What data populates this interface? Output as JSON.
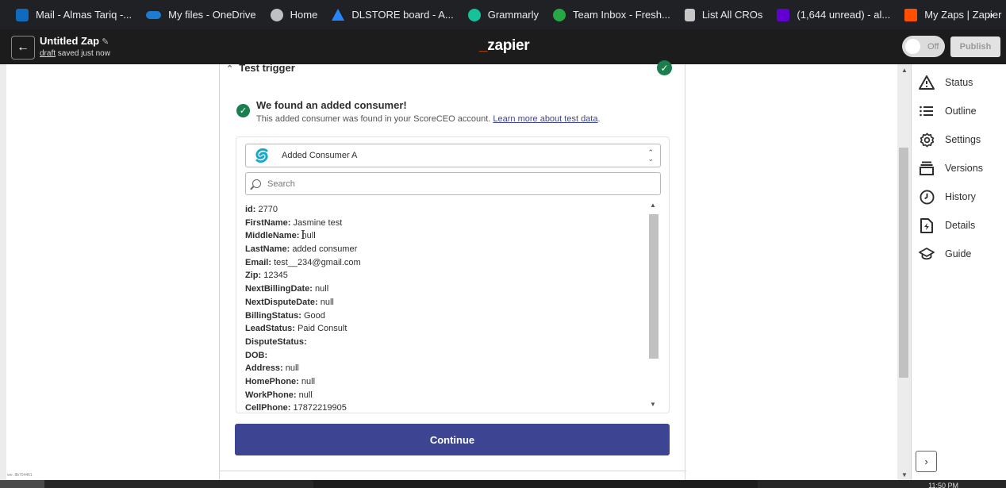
{
  "bookmarks": [
    {
      "label": "Mail - Almas Tariq -...",
      "icon": "outlook-icon",
      "color": "#0f6cbd"
    },
    {
      "label": "My files - OneDrive",
      "icon": "onedrive-icon",
      "color": "#1e7bd2"
    },
    {
      "label": "Home",
      "icon": "globe-icon",
      "color": "#bdc1c6"
    },
    {
      "label": "DLSTORE board - A...",
      "icon": "jira-icon",
      "color": "#2684ff"
    },
    {
      "label": "Grammarly",
      "icon": "grammarly-icon",
      "color": "#15c39a"
    },
    {
      "label": "Team Inbox - Fresh...",
      "icon": "freshchat-icon",
      "color": "#27a844"
    },
    {
      "label": "List All CROs",
      "icon": "doc-icon",
      "color": "#c7c7c7"
    },
    {
      "label": "(1,644 unread) - al...",
      "icon": "yahoo-icon",
      "color": "#6001d2"
    },
    {
      "label": "My Zaps | Zapier",
      "icon": "zapier-icon",
      "color": "#ff4f00"
    }
  ],
  "bookmarks_more": "»",
  "header": {
    "title": "Untitled Zap",
    "draft_label": "draft",
    "saved_text": "saved just now",
    "logo": "zapier",
    "toggle_label": "Off",
    "publish_label": "Publish"
  },
  "step": {
    "section_title": "Test trigger",
    "found_title": "We found an added consumer!",
    "found_desc": "This added consumer was found in your ScoreCEO account.",
    "learn_more": "Learn more about test data",
    "period": ".",
    "selected_record": "Added Consumer A",
    "search_placeholder": "Search",
    "fields": [
      {
        "k": "id:",
        "v": "2770"
      },
      {
        "k": "FirstName:",
        "v": "Jasmine test"
      },
      {
        "k": "MiddleName:",
        "v": "null"
      },
      {
        "k": "LastName:",
        "v": "added consumer"
      },
      {
        "k": "Email:",
        "v": "test__234@gmail.com"
      },
      {
        "k": "Zip:",
        "v": "12345"
      },
      {
        "k": "NextBillingDate:",
        "v": "null"
      },
      {
        "k": "NextDisputeDate:",
        "v": "null"
      },
      {
        "k": "BillingStatus:",
        "v": "Good"
      },
      {
        "k": "LeadStatus:",
        "v": "Paid Consult"
      },
      {
        "k": "DisputeStatus:",
        "v": ""
      },
      {
        "k": "DOB:",
        "v": ""
      },
      {
        "k": "Address:",
        "v": "null"
      },
      {
        "k": "HomePhone:",
        "v": "null"
      },
      {
        "k": "WorkPhone:",
        "v": "null"
      },
      {
        "k": "CellPhone:",
        "v": "17872219905"
      }
    ],
    "continue_label": "Continue"
  },
  "sidebar": {
    "items": [
      {
        "label": "Status",
        "icon": "warning-icon"
      },
      {
        "label": "Outline",
        "icon": "list-icon"
      },
      {
        "label": "Settings",
        "icon": "gear-icon"
      },
      {
        "label": "Versions",
        "icon": "versions-icon"
      },
      {
        "label": "History",
        "icon": "clock-icon"
      },
      {
        "label": "Details",
        "icon": "file-bolt-icon"
      },
      {
        "label": "Guide",
        "icon": "graduation-cap-icon"
      }
    ]
  },
  "footer": {
    "time": "11:50 PM",
    "version": "ver. 8b704461"
  }
}
